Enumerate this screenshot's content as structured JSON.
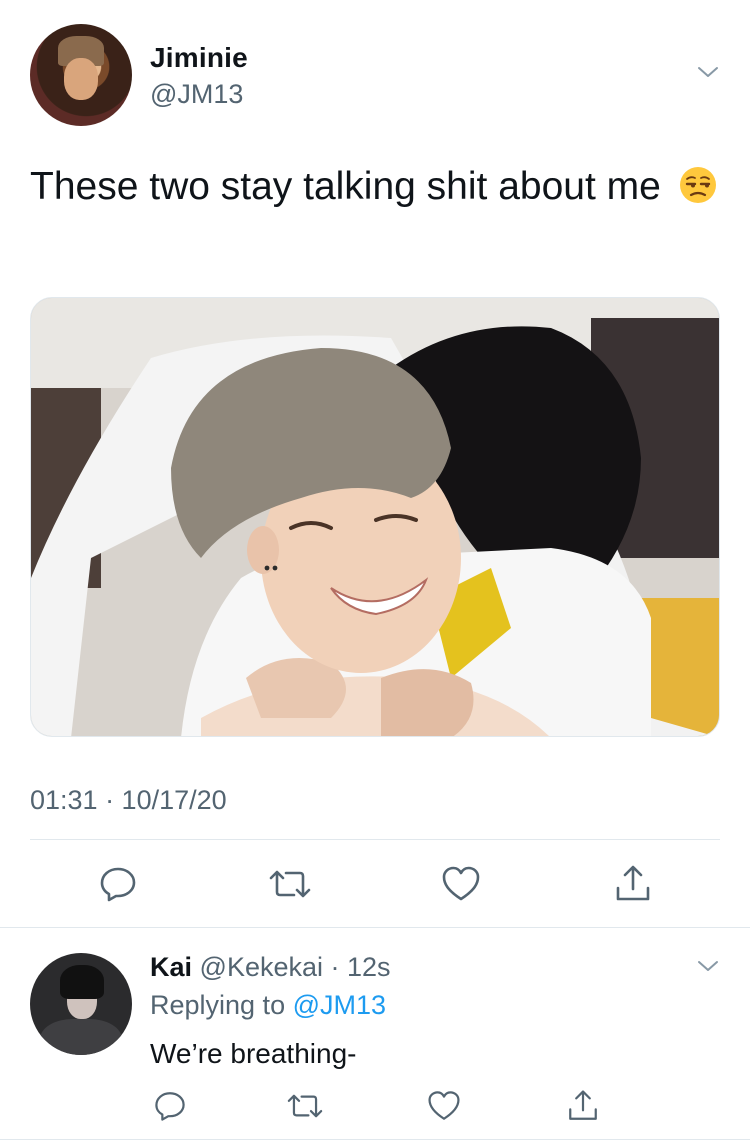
{
  "main_tweet": {
    "author_name": "Jiminie",
    "author_handle": "@JM13",
    "text": "These two stay talking shit about me",
    "emoji": "unamused-face-emoji",
    "media": "photo-two-people-hugging",
    "timestamp": "01:31 · 10/17/20",
    "actions": [
      "reply-icon",
      "retweet-icon",
      "like-icon",
      "share-icon"
    ]
  },
  "reply_tweet": {
    "author_name": "Kai",
    "author_handle": "@Kekekai",
    "time_ago": "· 12s",
    "replying_prefix": "Replying to",
    "replying_to": "@JM13",
    "text": "We’re breathing-",
    "actions": [
      "reply-icon",
      "retweet-icon",
      "like-icon",
      "share-icon"
    ]
  },
  "colors": {
    "text_primary": "#0f1419",
    "text_secondary": "#536471",
    "link": "#1d9bf0",
    "divider": "#e1e8ed"
  }
}
